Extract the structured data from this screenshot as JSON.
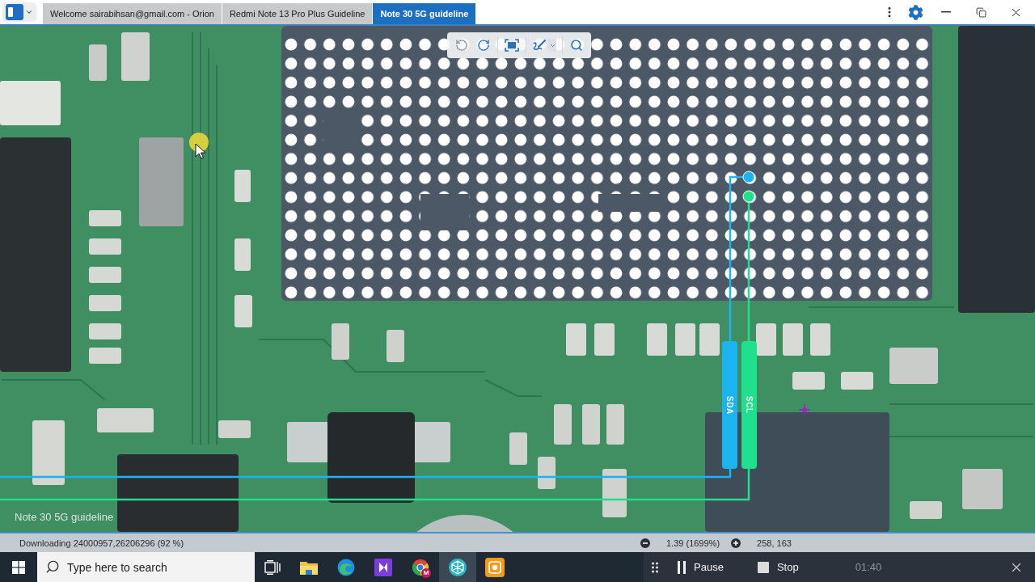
{
  "title_bar": {
    "tabs": [
      {
        "label": "Welcome sairabihsan@gmail.com - Orion",
        "selected": false
      },
      {
        "label": "Redmi Note 13 Pro Plus Guideline",
        "selected": false
      },
      {
        "label": "Note 30 5G guideline",
        "selected": true
      }
    ]
  },
  "viewer": {
    "signals": [
      {
        "label": "SDA",
        "color": "#1cb4f0"
      },
      {
        "label": "SCL",
        "color": "#1fe08d"
      }
    ],
    "caption": "Note 30 5G guideline"
  },
  "status_bar": {
    "download": "Downloading 24000957,26206296 (92 %)",
    "zoom": "1.39 (1699%)",
    "coordinates": "258, 163"
  },
  "taskbar": {
    "search": {
      "placeholder": "Type here to search"
    },
    "apps": [
      {
        "selected": false
      },
      {
        "selected": false
      },
      {
        "selected": false
      },
      {
        "selected": false,
        "badge": "M"
      },
      {
        "selected": true
      },
      {
        "selected": false
      }
    ]
  },
  "recorder": {
    "pause": "Pause",
    "stop": "Stop",
    "timer": "01:40"
  }
}
